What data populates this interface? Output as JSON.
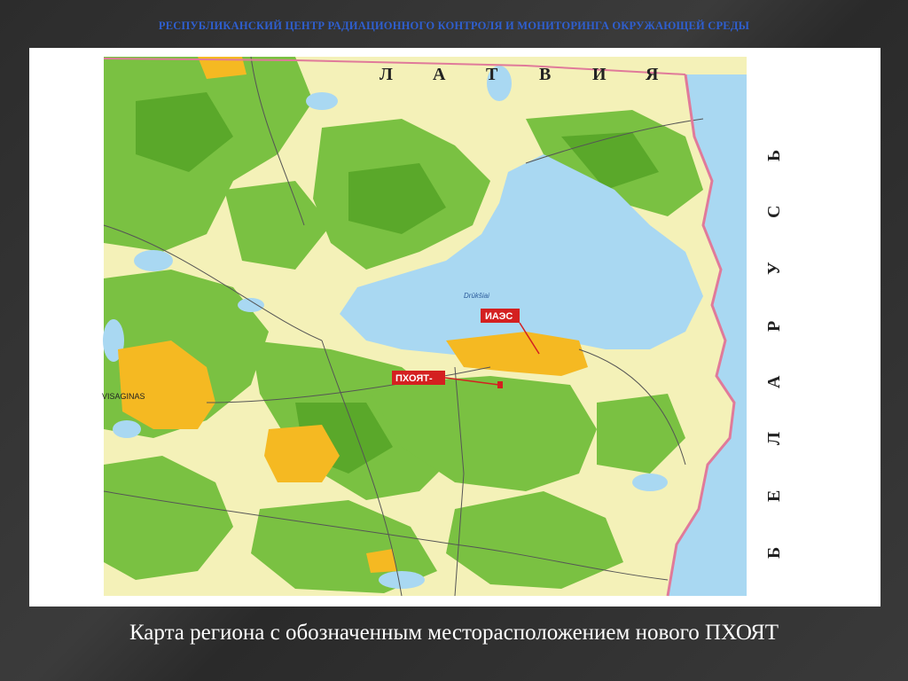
{
  "header": {
    "title": "РЕСПУБЛИКАНСКИЙ ЦЕНТР РАДИАЦИОННОГО КОНТРОЛЯ И МОНИТОРИНГА ОКРУЖАЮЩЕЙ СРЕДЫ"
  },
  "map": {
    "country_top": [
      "Л",
      "А",
      "Т",
      "В",
      "И",
      "Я"
    ],
    "country_right": [
      "Б",
      "Е",
      "Л",
      "А",
      "Р",
      "У",
      "С",
      "Ь"
    ],
    "labels": {
      "plant": "ИАЭС",
      "storage": "ПХОЯТ-",
      "town": "VISAGINAS",
      "lake": "Drūkšiai"
    },
    "colors": {
      "forest": "#7ac142",
      "forest_dark": "#5aa82a",
      "field": "#f4f1b8",
      "water": "#a9d8f2",
      "urban": "#f5b922",
      "border": "#e07a9a",
      "marker": "#d42020"
    }
  },
  "caption": {
    "text": "Карта региона с обозначенным месторасположением нового ПХОЯТ"
  }
}
